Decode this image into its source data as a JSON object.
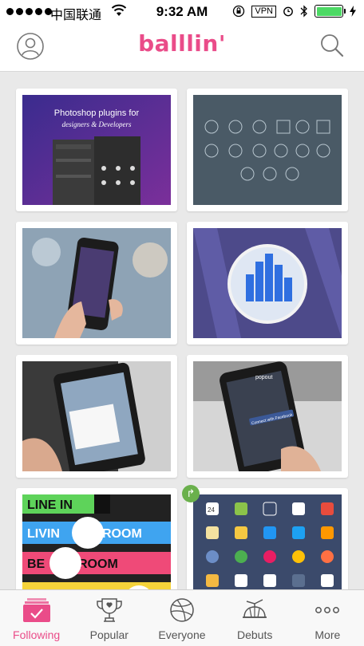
{
  "status_bar": {
    "carrier": "中国联通",
    "time": "9:32 AM",
    "vpn": "VPN"
  },
  "header": {
    "logo": "balllin'",
    "left_icon": "profile-icon",
    "right_icon": "search-icon"
  },
  "shots": [
    {
      "title": "Photoshop plugins for",
      "subtitle": "designers & Developers"
    },
    {
      "title": ""
    },
    {
      "title": ""
    },
    {
      "title": ""
    },
    {
      "title": ""
    },
    {
      "title": "popout",
      "button": "Connect with Facebook"
    },
    {
      "lines": [
        "LINE IN",
        "LIVIN",
        "ROOM",
        "BE",
        "ROOM"
      ]
    },
    {
      "icons_row": "24"
    }
  ],
  "tabs": [
    {
      "label": "Following",
      "icon": "following-icon",
      "active": true
    },
    {
      "label": "Popular",
      "icon": "trophy-icon"
    },
    {
      "label": "Everyone",
      "icon": "dribbble-ball-icon"
    },
    {
      "label": "Debuts",
      "icon": "propeller-hat-icon"
    },
    {
      "label": "More",
      "icon": "more-dots-icon"
    }
  ],
  "colors": {
    "brand": "#ea4c89",
    "background": "#e9e9e9"
  }
}
